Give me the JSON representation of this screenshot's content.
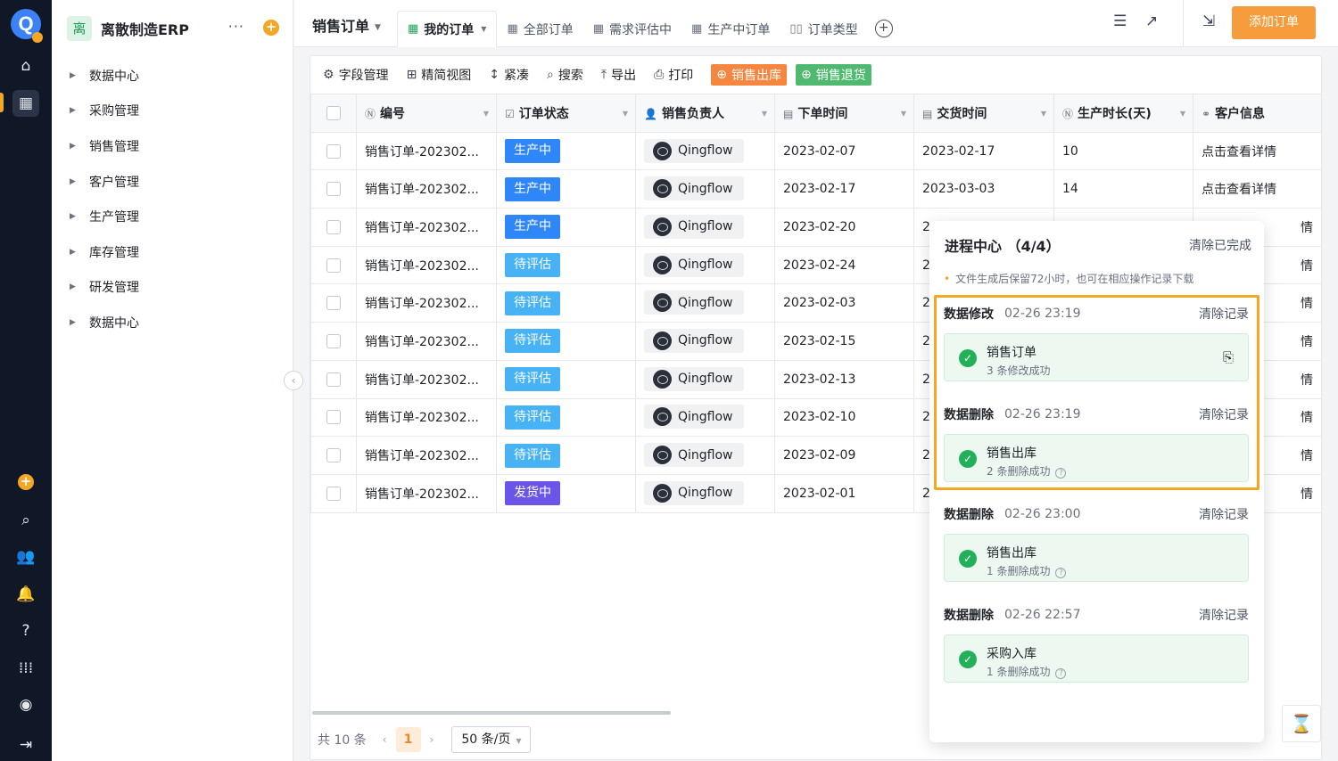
{
  "rail": {
    "logo": "Q",
    "icons": [
      "home-icon",
      "apps-icon",
      "add-icon",
      "search-icon",
      "contacts-icon",
      "bell-icon",
      "help-icon",
      "grid-icon",
      "avatar-icon",
      "expand-icon"
    ]
  },
  "app": {
    "badge": "离",
    "name": "离散制造ERP",
    "more": "···",
    "plus": "+"
  },
  "menu": [
    "数据中心",
    "采购管理",
    "销售管理",
    "客户管理",
    "生产管理",
    "库存管理",
    "研发管理",
    "数据中心"
  ],
  "topbar": {
    "title": "销售订单",
    "tabs": [
      "我的订单",
      "全部订单",
      "需求评估中",
      "生产中订单",
      "订单类型"
    ],
    "add_order": "添加订单"
  },
  "toolbar": {
    "field_manage": "字段管理",
    "simple_view": "精简视图",
    "compact": "紧凑",
    "search": "搜索",
    "export": "导出",
    "print": "打印",
    "sales_out": "销售出库",
    "sales_return": "销售退货"
  },
  "table": {
    "headers": [
      "编号",
      "订单状态",
      "销售负责人",
      "下单时间",
      "交货时间",
      "生产时长(天)",
      "客户信息"
    ],
    "rows": [
      {
        "id": "销售订单-202302...",
        "status": "生产中",
        "owner": "Qingflow",
        "order_date": "2023-02-07",
        "delivery": "2023-02-17",
        "days": "10",
        "info": "点击查看详情"
      },
      {
        "id": "销售订单-202302...",
        "status": "生产中",
        "owner": "Qingflow",
        "order_date": "2023-02-17",
        "delivery": "2023-03-03",
        "days": "14",
        "info": "点击查看详情"
      },
      {
        "id": "销售订单-202302...",
        "status": "生产中",
        "owner": "Qingflow",
        "order_date": "2023-02-20",
        "delivery": "2",
        "days": "",
        "info": "情"
      },
      {
        "id": "销售订单-202302...",
        "status": "待评估",
        "owner": "Qingflow",
        "order_date": "2023-02-24",
        "delivery": "2",
        "days": "",
        "info": "情"
      },
      {
        "id": "销售订单-202302...",
        "status": "待评估",
        "owner": "Qingflow",
        "order_date": "2023-02-03",
        "delivery": "2",
        "days": "",
        "info": "情"
      },
      {
        "id": "销售订单-202302...",
        "status": "待评估",
        "owner": "Qingflow",
        "order_date": "2023-02-15",
        "delivery": "2",
        "days": "",
        "info": "情"
      },
      {
        "id": "销售订单-202302...",
        "status": "待评估",
        "owner": "Qingflow",
        "order_date": "2023-02-13",
        "delivery": "2",
        "days": "",
        "info": "情"
      },
      {
        "id": "销售订单-202302...",
        "status": "待评估",
        "owner": "Qingflow",
        "order_date": "2023-02-10",
        "delivery": "2",
        "days": "",
        "info": "情"
      },
      {
        "id": "销售订单-202302...",
        "status": "待评估",
        "owner": "Qingflow",
        "order_date": "2023-02-09",
        "delivery": "2",
        "days": "",
        "info": "情"
      },
      {
        "id": "销售订单-202302...",
        "status": "发货中",
        "owner": "Qingflow",
        "order_date": "2023-02-01",
        "delivery": "2",
        "days": "",
        "info": "情"
      }
    ]
  },
  "status_colors": {
    "生产中": "#2f86f6",
    "待评估": "#47b3f5",
    "发货中": "#6b54e8"
  },
  "pager": {
    "total": "共 10 条",
    "page": "1",
    "size": "50 条/页"
  },
  "progress": {
    "title": "进程中心 （4/4）",
    "clear_done": "清除已完成",
    "note": "文件生成后保留72小时，也可在相应操作记录下载",
    "groups": [
      {
        "type": "数据修改",
        "time": "02-26 23:19",
        "clear": "清除记录",
        "name": "销售订单",
        "sub": "3 条修改成功",
        "download": true,
        "help": false
      },
      {
        "type": "数据删除",
        "time": "02-26 23:19",
        "clear": "清除记录",
        "name": "销售出库",
        "sub": "2 条删除成功",
        "download": false,
        "help": true
      },
      {
        "type": "数据删除",
        "time": "02-26 23:00",
        "clear": "清除记录",
        "name": "销售出库",
        "sub": "1 条删除成功",
        "download": false,
        "help": true
      },
      {
        "type": "数据删除",
        "time": "02-26 22:57",
        "clear": "清除记录",
        "name": "采购入库",
        "sub": "1 条删除成功",
        "download": false,
        "help": true
      }
    ]
  },
  "accent": "#f5a623"
}
